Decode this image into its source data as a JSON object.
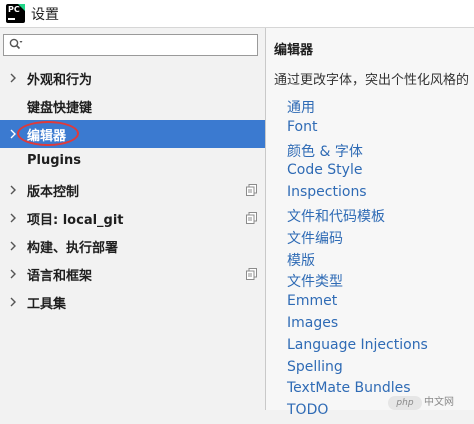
{
  "window": {
    "title": "设置",
    "app_logo_text": "PC"
  },
  "search": {
    "value": "",
    "placeholder": ""
  },
  "sidebar": {
    "items": [
      {
        "label": "外观和行为",
        "expandable": true,
        "selected": false,
        "has_project_icon": false
      },
      {
        "label": "键盘快捷键",
        "expandable": false,
        "selected": false,
        "has_project_icon": false
      },
      {
        "label": "编辑器",
        "expandable": true,
        "selected": true,
        "has_project_icon": false
      },
      {
        "label": "Plugins",
        "expandable": false,
        "selected": false,
        "has_project_icon": false
      },
      {
        "label": "版本控制",
        "expandable": true,
        "selected": false,
        "has_project_icon": true
      },
      {
        "label": "项目: local_git",
        "expandable": true,
        "selected": false,
        "has_project_icon": true
      },
      {
        "label": "构建、执行部署",
        "expandable": true,
        "selected": false,
        "has_project_icon": false
      },
      {
        "label": "语言和框架",
        "expandable": true,
        "selected": false,
        "has_project_icon": true
      },
      {
        "label": "工具集",
        "expandable": true,
        "selected": false,
        "has_project_icon": false
      }
    ]
  },
  "content": {
    "title": "编辑器",
    "description": "通过更改字体，突出个性化风格的",
    "links": [
      "通用",
      "Font",
      "颜色 & 字体",
      "Code Style",
      "Inspections",
      "文件和代码模板",
      "文件编码",
      "模版",
      "文件类型",
      "Emmet",
      "Images",
      "Language Injections",
      "Spelling",
      "TextMate Bundles",
      "TODO"
    ]
  },
  "watermark": {
    "logo_text": "php",
    "text": "中文网"
  },
  "colors": {
    "selection": "#3b7ad0",
    "link": "#2f6bb5",
    "annotation_ring": "#e03a3a"
  }
}
